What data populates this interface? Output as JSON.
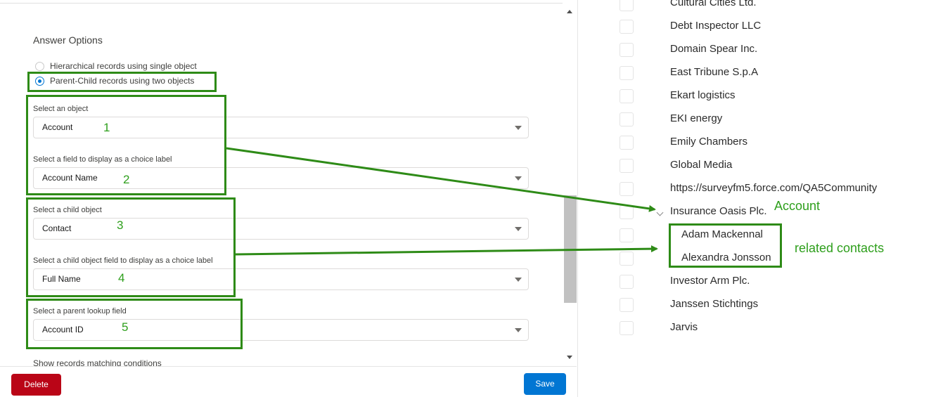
{
  "form": {
    "section_title": "Answer Options",
    "radio_options": [
      {
        "label": "Hierarchical records using single object",
        "checked": false
      },
      {
        "label": "Parent-Child records using two objects",
        "checked": true
      }
    ],
    "fields": [
      {
        "label": "Select an object",
        "value": "Account",
        "marker": "1"
      },
      {
        "label": "Select a field to display as a choice label",
        "value": "Account Name",
        "marker": "2"
      },
      {
        "label": "Select a child object",
        "value": "Contact",
        "marker": "3"
      },
      {
        "label": "Select a child object field to display as a choice label",
        "value": "Full Name",
        "marker": "4"
      },
      {
        "label": "Select a parent lookup field",
        "value": "Account ID",
        "marker": "5"
      }
    ],
    "cut_off_label": "Show records matching conditions",
    "delete_label": "Delete",
    "save_label": "Save"
  },
  "preview": {
    "items": [
      "Cultural Cities Ltd.",
      "Debt Inspector LLC",
      "Domain Spear Inc.",
      "East Tribune S.p.A",
      "Ekart logistics",
      "EKI energy",
      "Emily Chambers",
      "Global Media",
      "https://surveyfm5.force.com/QA5Community",
      "Insurance Oasis Plc.",
      "Investor Arm Plc.",
      "Janssen Stichtings",
      "Jarvis"
    ],
    "children": [
      "Adam Mackennal",
      "Alexandra Jonsson"
    ]
  },
  "annotations": {
    "account": "Account",
    "related_contacts": "related contacts",
    "highlight_color": "#2e8b17"
  },
  "colors": {
    "primary": "#0176d3",
    "destructive": "#ba0517",
    "annotation_green": "#2e9f1c"
  }
}
